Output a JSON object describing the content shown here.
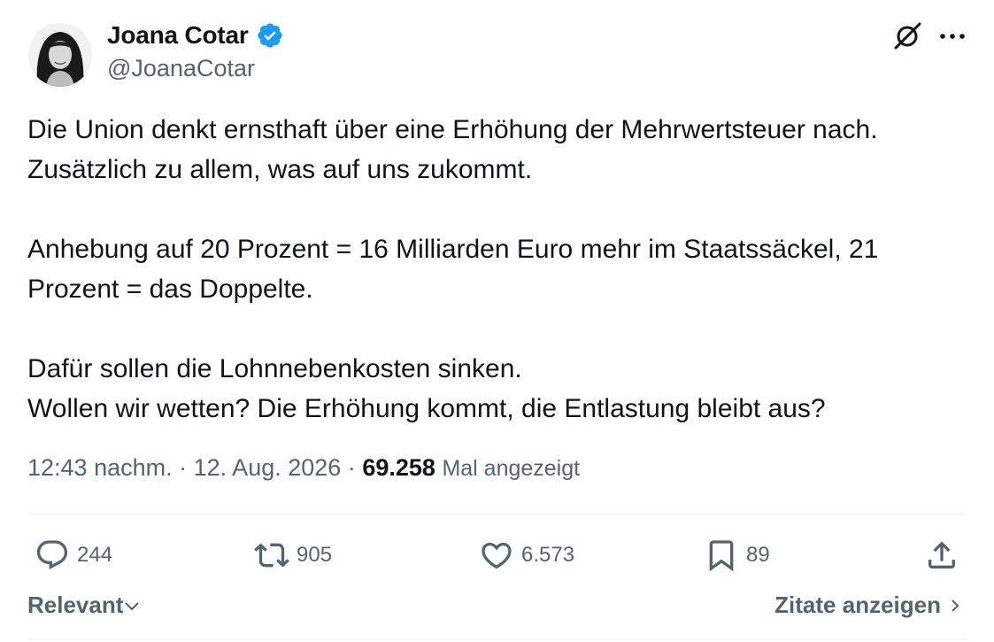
{
  "author": {
    "display_name": "Joana Cotar",
    "handle": "@JoanaCotar",
    "verified": true
  },
  "tweet": {
    "paragraphs": [
      [
        "Die Union denkt ernsthaft über eine Erhöhung der Mehrwertsteuer nach.",
        "Zusätzlich zu allem, was auf uns zukommt."
      ],
      [
        "Anhebung auf 20 Prozent = 16 Milliarden Euro mehr im Staatssäckel, 21",
        "Prozent = das Doppelte."
      ],
      [
        "Dafür sollen die Lohnnebenkosten sinken.",
        "Wollen wir wetten? Die Erhöhung kommt, die Entlastung bleibt aus?"
      ]
    ],
    "time": "12:43 nachm.",
    "date": "12. Aug. 2026",
    "separator": "·",
    "views_count": "69.258",
    "views_label": "Mal angezeigt"
  },
  "actions": {
    "reply_count": "244",
    "retweet_count": "905",
    "like_count": "6.573",
    "bookmark_count": "89"
  },
  "footer": {
    "sort_label": "Relevant",
    "quotes_label": "Zitate anzeigen"
  },
  "icons": {
    "verified": "verified-badge-icon",
    "grok": "grok-icon",
    "more": "more-icon",
    "reply": "reply-icon",
    "retweet": "retweet-icon",
    "like": "heart-icon",
    "bookmark": "bookmark-icon",
    "share": "share-icon"
  },
  "colors": {
    "text": "#0f1419",
    "secondary": "#536471",
    "verified": "#1d9bf0",
    "divider": "#eff3f4"
  }
}
